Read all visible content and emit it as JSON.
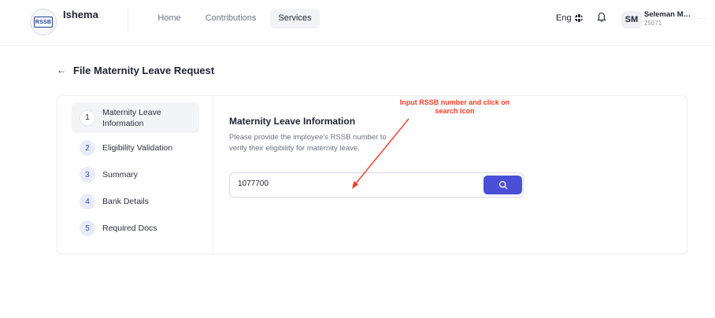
{
  "app": {
    "logo_text": "RSSB",
    "brand": "Ishema"
  },
  "nav": [
    {
      "label": "Home",
      "active": false
    },
    {
      "label": "Contributions",
      "active": false
    },
    {
      "label": "Services",
      "active": true
    }
  ],
  "header": {
    "language": "Eng",
    "user_initials": "SM",
    "user_name": "Seleman Majyambere",
    "user_id": "25071",
    "overflow": "..."
  },
  "page": {
    "back_icon": "arrow-left-icon",
    "title": "File Maternity Leave Request"
  },
  "steps": [
    {
      "number": "1",
      "label": "Maternity Leave Information",
      "active": true
    },
    {
      "number": "2",
      "label": "Eligibility Validation",
      "active": false
    },
    {
      "number": "3",
      "label": "Summary",
      "active": false
    },
    {
      "number": "4",
      "label": "Bank Details",
      "active": false
    },
    {
      "number": "5",
      "label": "Required Docs",
      "active": false
    }
  ],
  "form": {
    "section_title": "Maternity Leave Information",
    "section_description": "Please provide the imployee's RSSB number to verify their eligibility for maternity leave.",
    "rssb_value": "1077700",
    "search_icon": "search-icon"
  },
  "annotation": {
    "text": "Input RSSB number and click on search Icon",
    "color": "#f03c28"
  },
  "colors": {
    "accent": "#4a4fd6",
    "step_badge": "#e9ecf8"
  }
}
